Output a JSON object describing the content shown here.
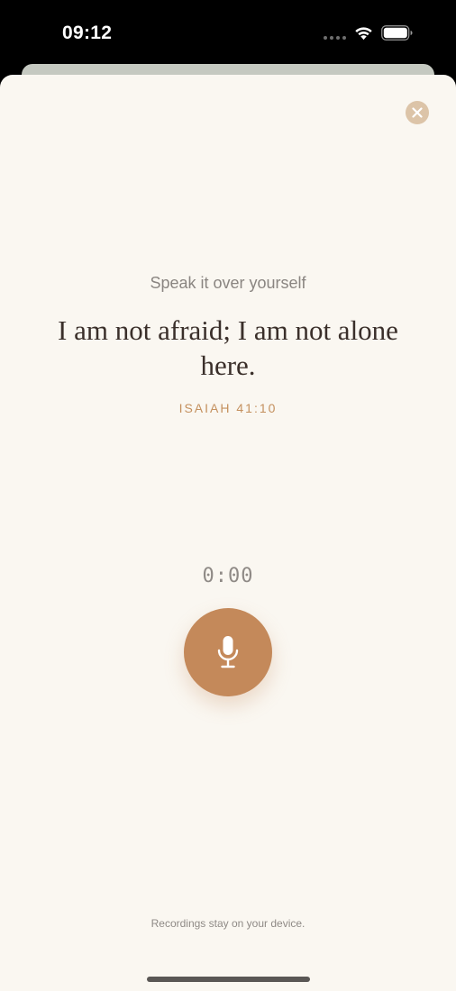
{
  "status_bar": {
    "time": "09:12"
  },
  "sheet": {
    "prompt": "Speak it over yourself",
    "affirmation": "I am not afraid; I am not alone here.",
    "reference": "ISAIAH 41:10",
    "timer": "0:00",
    "footnote": "Recordings stay on your device."
  },
  "icons": {
    "close": "close-icon",
    "microphone": "microphone-icon",
    "wifi": "wifi-icon",
    "battery": "battery-icon",
    "signal": "signal-icon"
  },
  "colors": {
    "accent": "#c4895a",
    "reference": "#c4905e",
    "sheet_background": "#faf7f1",
    "close_button": "#dcc4a8"
  }
}
